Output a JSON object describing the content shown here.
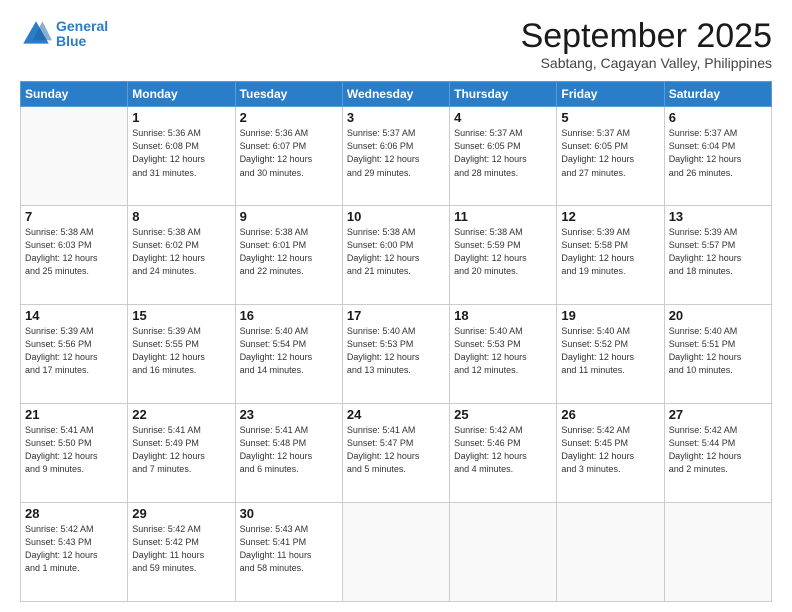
{
  "header": {
    "logo_line1": "General",
    "logo_line2": "Blue",
    "title": "September 2025",
    "subtitle": "Sabtang, Cagayan Valley, Philippines"
  },
  "weekdays": [
    "Sunday",
    "Monday",
    "Tuesday",
    "Wednesday",
    "Thursday",
    "Friday",
    "Saturday"
  ],
  "weeks": [
    [
      {
        "num": "",
        "info": ""
      },
      {
        "num": "1",
        "info": "Sunrise: 5:36 AM\nSunset: 6:08 PM\nDaylight: 12 hours\nand 31 minutes."
      },
      {
        "num": "2",
        "info": "Sunrise: 5:36 AM\nSunset: 6:07 PM\nDaylight: 12 hours\nand 30 minutes."
      },
      {
        "num": "3",
        "info": "Sunrise: 5:37 AM\nSunset: 6:06 PM\nDaylight: 12 hours\nand 29 minutes."
      },
      {
        "num": "4",
        "info": "Sunrise: 5:37 AM\nSunset: 6:05 PM\nDaylight: 12 hours\nand 28 minutes."
      },
      {
        "num": "5",
        "info": "Sunrise: 5:37 AM\nSunset: 6:05 PM\nDaylight: 12 hours\nand 27 minutes."
      },
      {
        "num": "6",
        "info": "Sunrise: 5:37 AM\nSunset: 6:04 PM\nDaylight: 12 hours\nand 26 minutes."
      }
    ],
    [
      {
        "num": "7",
        "info": "Sunrise: 5:38 AM\nSunset: 6:03 PM\nDaylight: 12 hours\nand 25 minutes."
      },
      {
        "num": "8",
        "info": "Sunrise: 5:38 AM\nSunset: 6:02 PM\nDaylight: 12 hours\nand 24 minutes."
      },
      {
        "num": "9",
        "info": "Sunrise: 5:38 AM\nSunset: 6:01 PM\nDaylight: 12 hours\nand 22 minutes."
      },
      {
        "num": "10",
        "info": "Sunrise: 5:38 AM\nSunset: 6:00 PM\nDaylight: 12 hours\nand 21 minutes."
      },
      {
        "num": "11",
        "info": "Sunrise: 5:38 AM\nSunset: 5:59 PM\nDaylight: 12 hours\nand 20 minutes."
      },
      {
        "num": "12",
        "info": "Sunrise: 5:39 AM\nSunset: 5:58 PM\nDaylight: 12 hours\nand 19 minutes."
      },
      {
        "num": "13",
        "info": "Sunrise: 5:39 AM\nSunset: 5:57 PM\nDaylight: 12 hours\nand 18 minutes."
      }
    ],
    [
      {
        "num": "14",
        "info": "Sunrise: 5:39 AM\nSunset: 5:56 PM\nDaylight: 12 hours\nand 17 minutes."
      },
      {
        "num": "15",
        "info": "Sunrise: 5:39 AM\nSunset: 5:55 PM\nDaylight: 12 hours\nand 16 minutes."
      },
      {
        "num": "16",
        "info": "Sunrise: 5:40 AM\nSunset: 5:54 PM\nDaylight: 12 hours\nand 14 minutes."
      },
      {
        "num": "17",
        "info": "Sunrise: 5:40 AM\nSunset: 5:53 PM\nDaylight: 12 hours\nand 13 minutes."
      },
      {
        "num": "18",
        "info": "Sunrise: 5:40 AM\nSunset: 5:53 PM\nDaylight: 12 hours\nand 12 minutes."
      },
      {
        "num": "19",
        "info": "Sunrise: 5:40 AM\nSunset: 5:52 PM\nDaylight: 12 hours\nand 11 minutes."
      },
      {
        "num": "20",
        "info": "Sunrise: 5:40 AM\nSunset: 5:51 PM\nDaylight: 12 hours\nand 10 minutes."
      }
    ],
    [
      {
        "num": "21",
        "info": "Sunrise: 5:41 AM\nSunset: 5:50 PM\nDaylight: 12 hours\nand 9 minutes."
      },
      {
        "num": "22",
        "info": "Sunrise: 5:41 AM\nSunset: 5:49 PM\nDaylight: 12 hours\nand 7 minutes."
      },
      {
        "num": "23",
        "info": "Sunrise: 5:41 AM\nSunset: 5:48 PM\nDaylight: 12 hours\nand 6 minutes."
      },
      {
        "num": "24",
        "info": "Sunrise: 5:41 AM\nSunset: 5:47 PM\nDaylight: 12 hours\nand 5 minutes."
      },
      {
        "num": "25",
        "info": "Sunrise: 5:42 AM\nSunset: 5:46 PM\nDaylight: 12 hours\nand 4 minutes."
      },
      {
        "num": "26",
        "info": "Sunrise: 5:42 AM\nSunset: 5:45 PM\nDaylight: 12 hours\nand 3 minutes."
      },
      {
        "num": "27",
        "info": "Sunrise: 5:42 AM\nSunset: 5:44 PM\nDaylight: 12 hours\nand 2 minutes."
      }
    ],
    [
      {
        "num": "28",
        "info": "Sunrise: 5:42 AM\nSunset: 5:43 PM\nDaylight: 12 hours\nand 1 minute."
      },
      {
        "num": "29",
        "info": "Sunrise: 5:42 AM\nSunset: 5:42 PM\nDaylight: 11 hours\nand 59 minutes."
      },
      {
        "num": "30",
        "info": "Sunrise: 5:43 AM\nSunset: 5:41 PM\nDaylight: 11 hours\nand 58 minutes."
      },
      {
        "num": "",
        "info": ""
      },
      {
        "num": "",
        "info": ""
      },
      {
        "num": "",
        "info": ""
      },
      {
        "num": "",
        "info": ""
      }
    ]
  ]
}
